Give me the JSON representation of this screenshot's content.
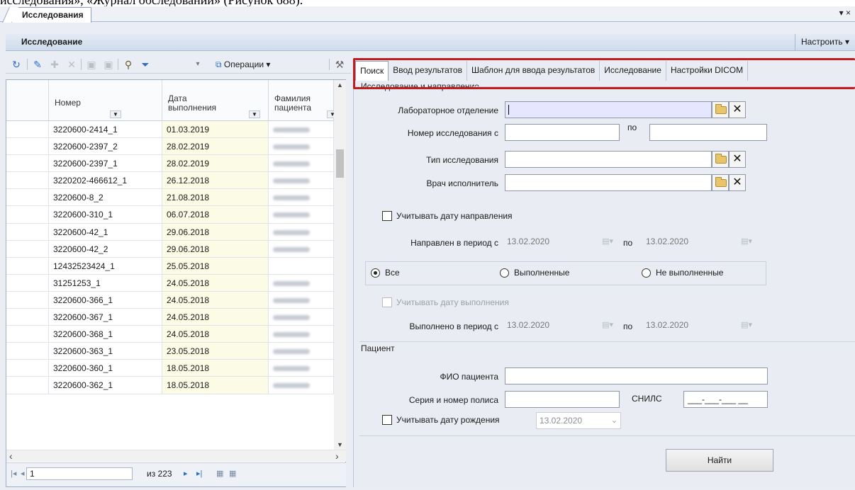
{
  "doc_text": "исследования», «Журнал обследований» (Рисунок 688).",
  "doc_tab": {
    "label": "Исследования",
    "menu": "▾ ×"
  },
  "header": {
    "title": "Исследование",
    "customize": "Настроить ▾"
  },
  "toolbar": {
    "operations": "Операции ▾"
  },
  "grid": {
    "columns": [
      {
        "label": ""
      },
      {
        "label": "Номер"
      },
      {
        "label": "Дата\nвыполнения"
      },
      {
        "label": "Фамилия\nпациента"
      }
    ],
    "rows": [
      {
        "num": "3220600-2414_1",
        "date": "01.03.2019"
      },
      {
        "num": "3220600-2397_2",
        "date": "28.02.2019"
      },
      {
        "num": "3220600-2397_1",
        "date": "28.02.2019"
      },
      {
        "num": "3220202-466612_1",
        "date": "26.12.2018"
      },
      {
        "num": "3220600-8_2",
        "date": "21.08.2018"
      },
      {
        "num": "3220600-310_1",
        "date": "06.07.2018"
      },
      {
        "num": "3220600-42_1",
        "date": "29.06.2018"
      },
      {
        "num": "3220600-42_2",
        "date": "29.06.2018"
      },
      {
        "num": "12432523424_1",
        "date": "25.05.2018"
      },
      {
        "num": "31251253_1",
        "date": "24.05.2018"
      },
      {
        "num": "3220600-366_1",
        "date": "24.05.2018"
      },
      {
        "num": "3220600-367_1",
        "date": "24.05.2018"
      },
      {
        "num": "3220600-368_1",
        "date": "24.05.2018"
      },
      {
        "num": "3220600-363_1",
        "date": "23.05.2018"
      },
      {
        "num": "3220600-360_1",
        "date": "18.05.2018"
      },
      {
        "num": "3220600-362_1",
        "date": "18.05.2018"
      }
    ],
    "pager": {
      "page": "1",
      "of": "из 223"
    }
  },
  "tabs": [
    "Поиск",
    "Ввод результатов",
    "Шаблон для ввода результатов",
    "Исследование",
    "Настройки DICOM"
  ],
  "form": {
    "section_study": "Исследование и направление",
    "lab_label": "Лабораторное отделение",
    "num_from_label": "Номер исследования с",
    "num_to_label": "по",
    "type_label": "Тип исследования",
    "doctor_label": "Врач исполнитель",
    "consider_dir_date": "Учитывать дату направления",
    "dir_period_label": "Направлен в период с",
    "dir_from": "13.02.2020",
    "dir_to_label": "по",
    "dir_to": "13.02.2020",
    "radio_all": "Все",
    "radio_done": "Выполненные",
    "radio_not_done": "Не выполненные",
    "consider_exec_date": "Учитывать дату выполнения",
    "exec_period_label": "Выполнено в период с",
    "exec_from": "13.02.2020",
    "exec_to_label": "по",
    "exec_to": "13.02.2020",
    "section_patient": "Пациент",
    "fio_label": "ФИО пациента",
    "policy_label": "Серия и номер полиса",
    "snils_label": "СНИЛС",
    "snils_mask": "___-___-___ __",
    "consider_birth": "Учитывать дату рождения",
    "birth_date": "13.02.2020",
    "find_button": "Найти"
  },
  "colors": {
    "highlight": "#c11d1d",
    "focus_field": "#e6e6ff",
    "date_column": "#fbfbe6"
  }
}
